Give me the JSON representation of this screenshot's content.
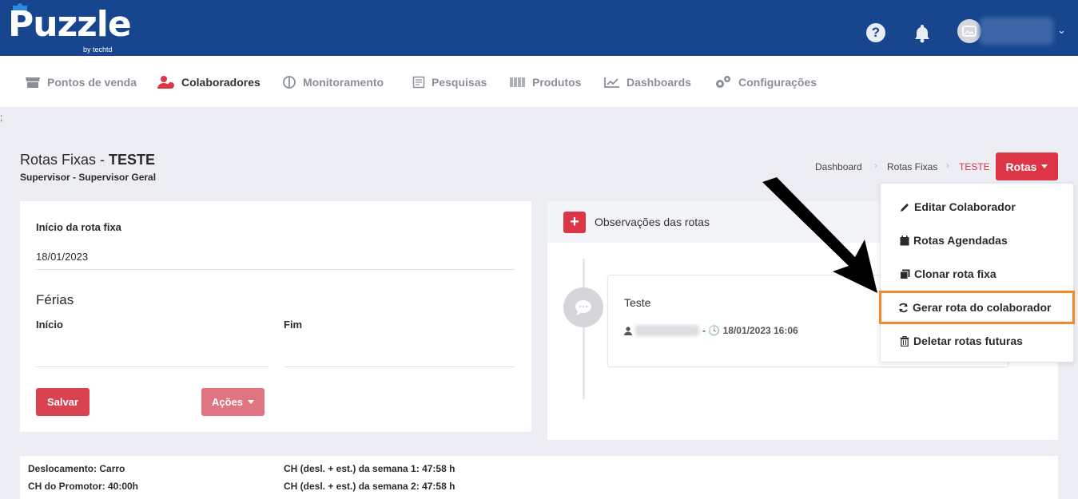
{
  "header": {
    "logo_text": "Puzzle",
    "logo_sub": "by techtd",
    "help_symbol": "?",
    "caret": "⌄"
  },
  "nav": {
    "items": [
      {
        "label": "Pontos de venda"
      },
      {
        "label": "Colaboradores"
      },
      {
        "label": "Monitoramento"
      },
      {
        "label": "Pesquisas"
      },
      {
        "label": "Produtos"
      },
      {
        "label": "Dashboards"
      },
      {
        "label": "Configurações"
      }
    ],
    "active": "Colaboradores"
  },
  "stray_text": ";",
  "page": {
    "title_prefix": "Rotas Fixas - ",
    "title_name": "TESTE",
    "subtitle": "Supervisor - Supervisor Geral"
  },
  "breadcrumb": {
    "items": [
      "Dashboard",
      "Rotas Fixas",
      "TESTE"
    ],
    "separator": "›"
  },
  "rotas_button": {
    "label": "Rotas"
  },
  "form": {
    "inicio_rota_label": "Início da rota fixa",
    "inicio_rota_value": "18/01/2023",
    "ferias_heading": "Férias",
    "inicio_label": "Início",
    "fim_label": "Fim",
    "salvar_label": "Salvar",
    "acoes_label": "Ações"
  },
  "observacoes": {
    "plus": "+",
    "title": "Observações das rotas",
    "comment_text": "Teste",
    "comment_meta": "- 🕓 18/01/2023 16:06"
  },
  "dropdown": {
    "items": [
      {
        "label": "Editar Colaborador",
        "icon": "pencil-icon"
      },
      {
        "label": "Rotas Agendadas",
        "icon": "calendar-icon"
      },
      {
        "label": "Clonar rota fixa",
        "icon": "copy-icon"
      },
      {
        "label": "Gerar rota do colaborador",
        "icon": "refresh-icon"
      },
      {
        "label": "Deletar rotas futuras",
        "icon": "trash-icon"
      }
    ],
    "highlighted": "Gerar rota do colaborador"
  },
  "info": {
    "deslocamento": "Deslocamento: Carro",
    "ch_promotor": "CH do Promotor: 40:00h",
    "semana1": "CH (desl. + est.) da semana 1: 47:58 h",
    "semana2": "CH (desl. + est.) da semana 2: 47:58 h"
  },
  "colors": {
    "topbar": "#17468e",
    "accent_red": "#dc3545",
    "highlight_orange": "#f18a2b"
  }
}
